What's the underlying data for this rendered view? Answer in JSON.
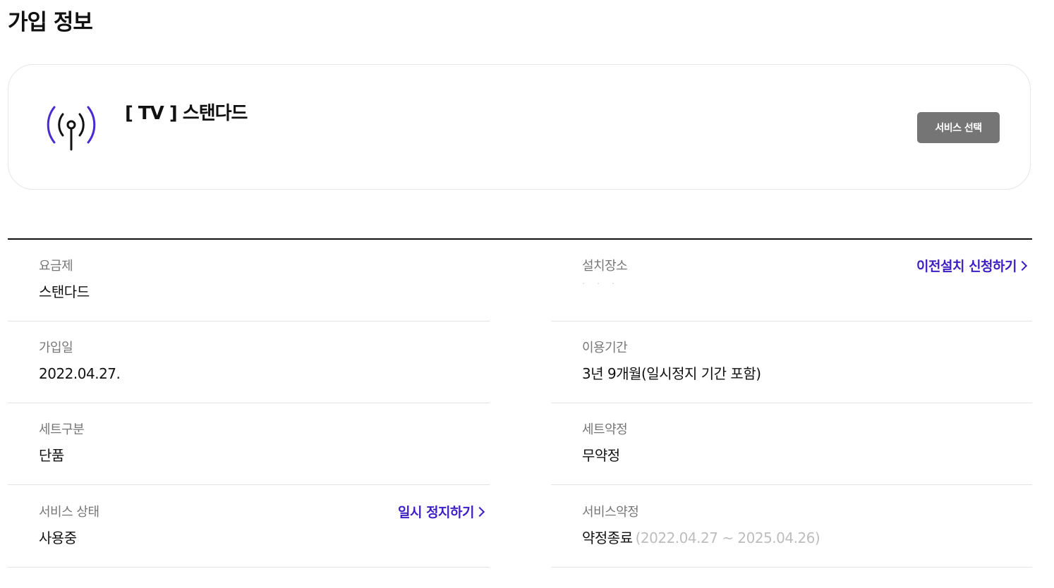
{
  "page": {
    "title": "가입 정보"
  },
  "service_card": {
    "icon": "broadcast-antenna-icon",
    "title": "[ TV ] 스탠다드",
    "select_button_label": "서비스 선택"
  },
  "info": {
    "plan": {
      "label": "요금제",
      "value": "스탠다드"
    },
    "install_location": {
      "label": "설치장소",
      "value": "· · ·",
      "action_label": "이전설치 신청하기"
    },
    "join_date": {
      "label": "가입일",
      "value": "2022.04.27."
    },
    "usage_period": {
      "label": "이용기간",
      "value": "3년 9개월(일시정지 기간 포함)"
    },
    "set_type": {
      "label": "세트구분",
      "value": "단품"
    },
    "set_contract": {
      "label": "세트약정",
      "value": "무약정"
    },
    "service_status": {
      "label": "서비스 상태",
      "value": "사용중",
      "action_label": "일시 정지하기"
    },
    "service_contract": {
      "label": "서비스약정",
      "value": "약정종료",
      "period": "(2022.04.27 ~ 2025.04.26)"
    }
  },
  "colors": {
    "accent": "#3d1fc4",
    "button_bg": "#757575",
    "icon_purple": "#4a2bd1"
  }
}
